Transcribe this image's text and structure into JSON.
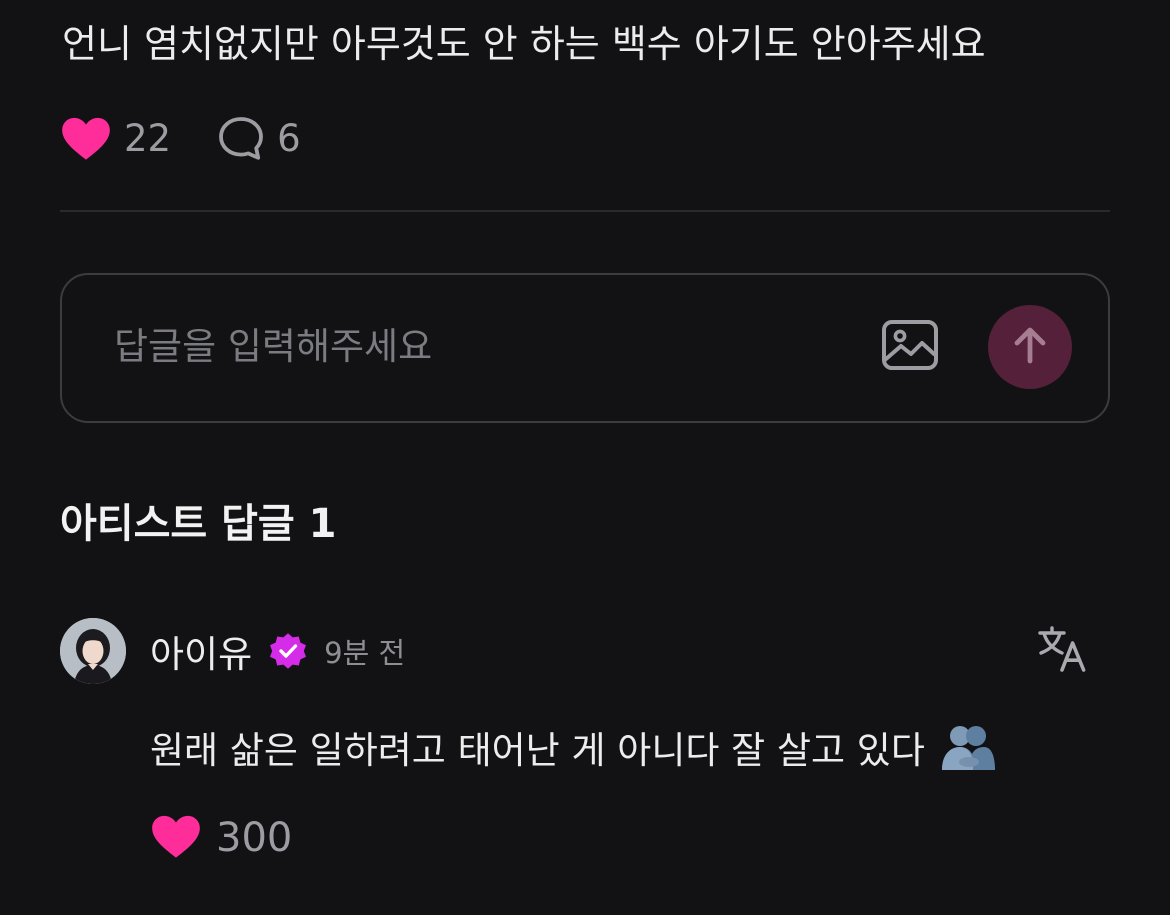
{
  "post": {
    "text": "언니 염치없지만 아무것도 안 하는 백수 아기도 안아주세요",
    "like_count": "22",
    "comment_count": "6"
  },
  "reply_input": {
    "placeholder": "답글을 입력해주세요",
    "image_icon": "image-icon",
    "send_icon": "arrow-up-icon"
  },
  "artist_replies": {
    "title": "아티스트 답글 1",
    "items": [
      {
        "author": "아이유",
        "timestamp": "9분 전",
        "text": "원래 삶은 일하려고 태어난 게 아니다 잘 살고 있다",
        "emoji": "people-hugging",
        "like_count": "300"
      }
    ]
  },
  "colors": {
    "background": "#121214",
    "heart": "#ff2d9a",
    "verified": "#d42ce8",
    "send_button": "#55203a",
    "muted_text": "#9c9ca2"
  }
}
